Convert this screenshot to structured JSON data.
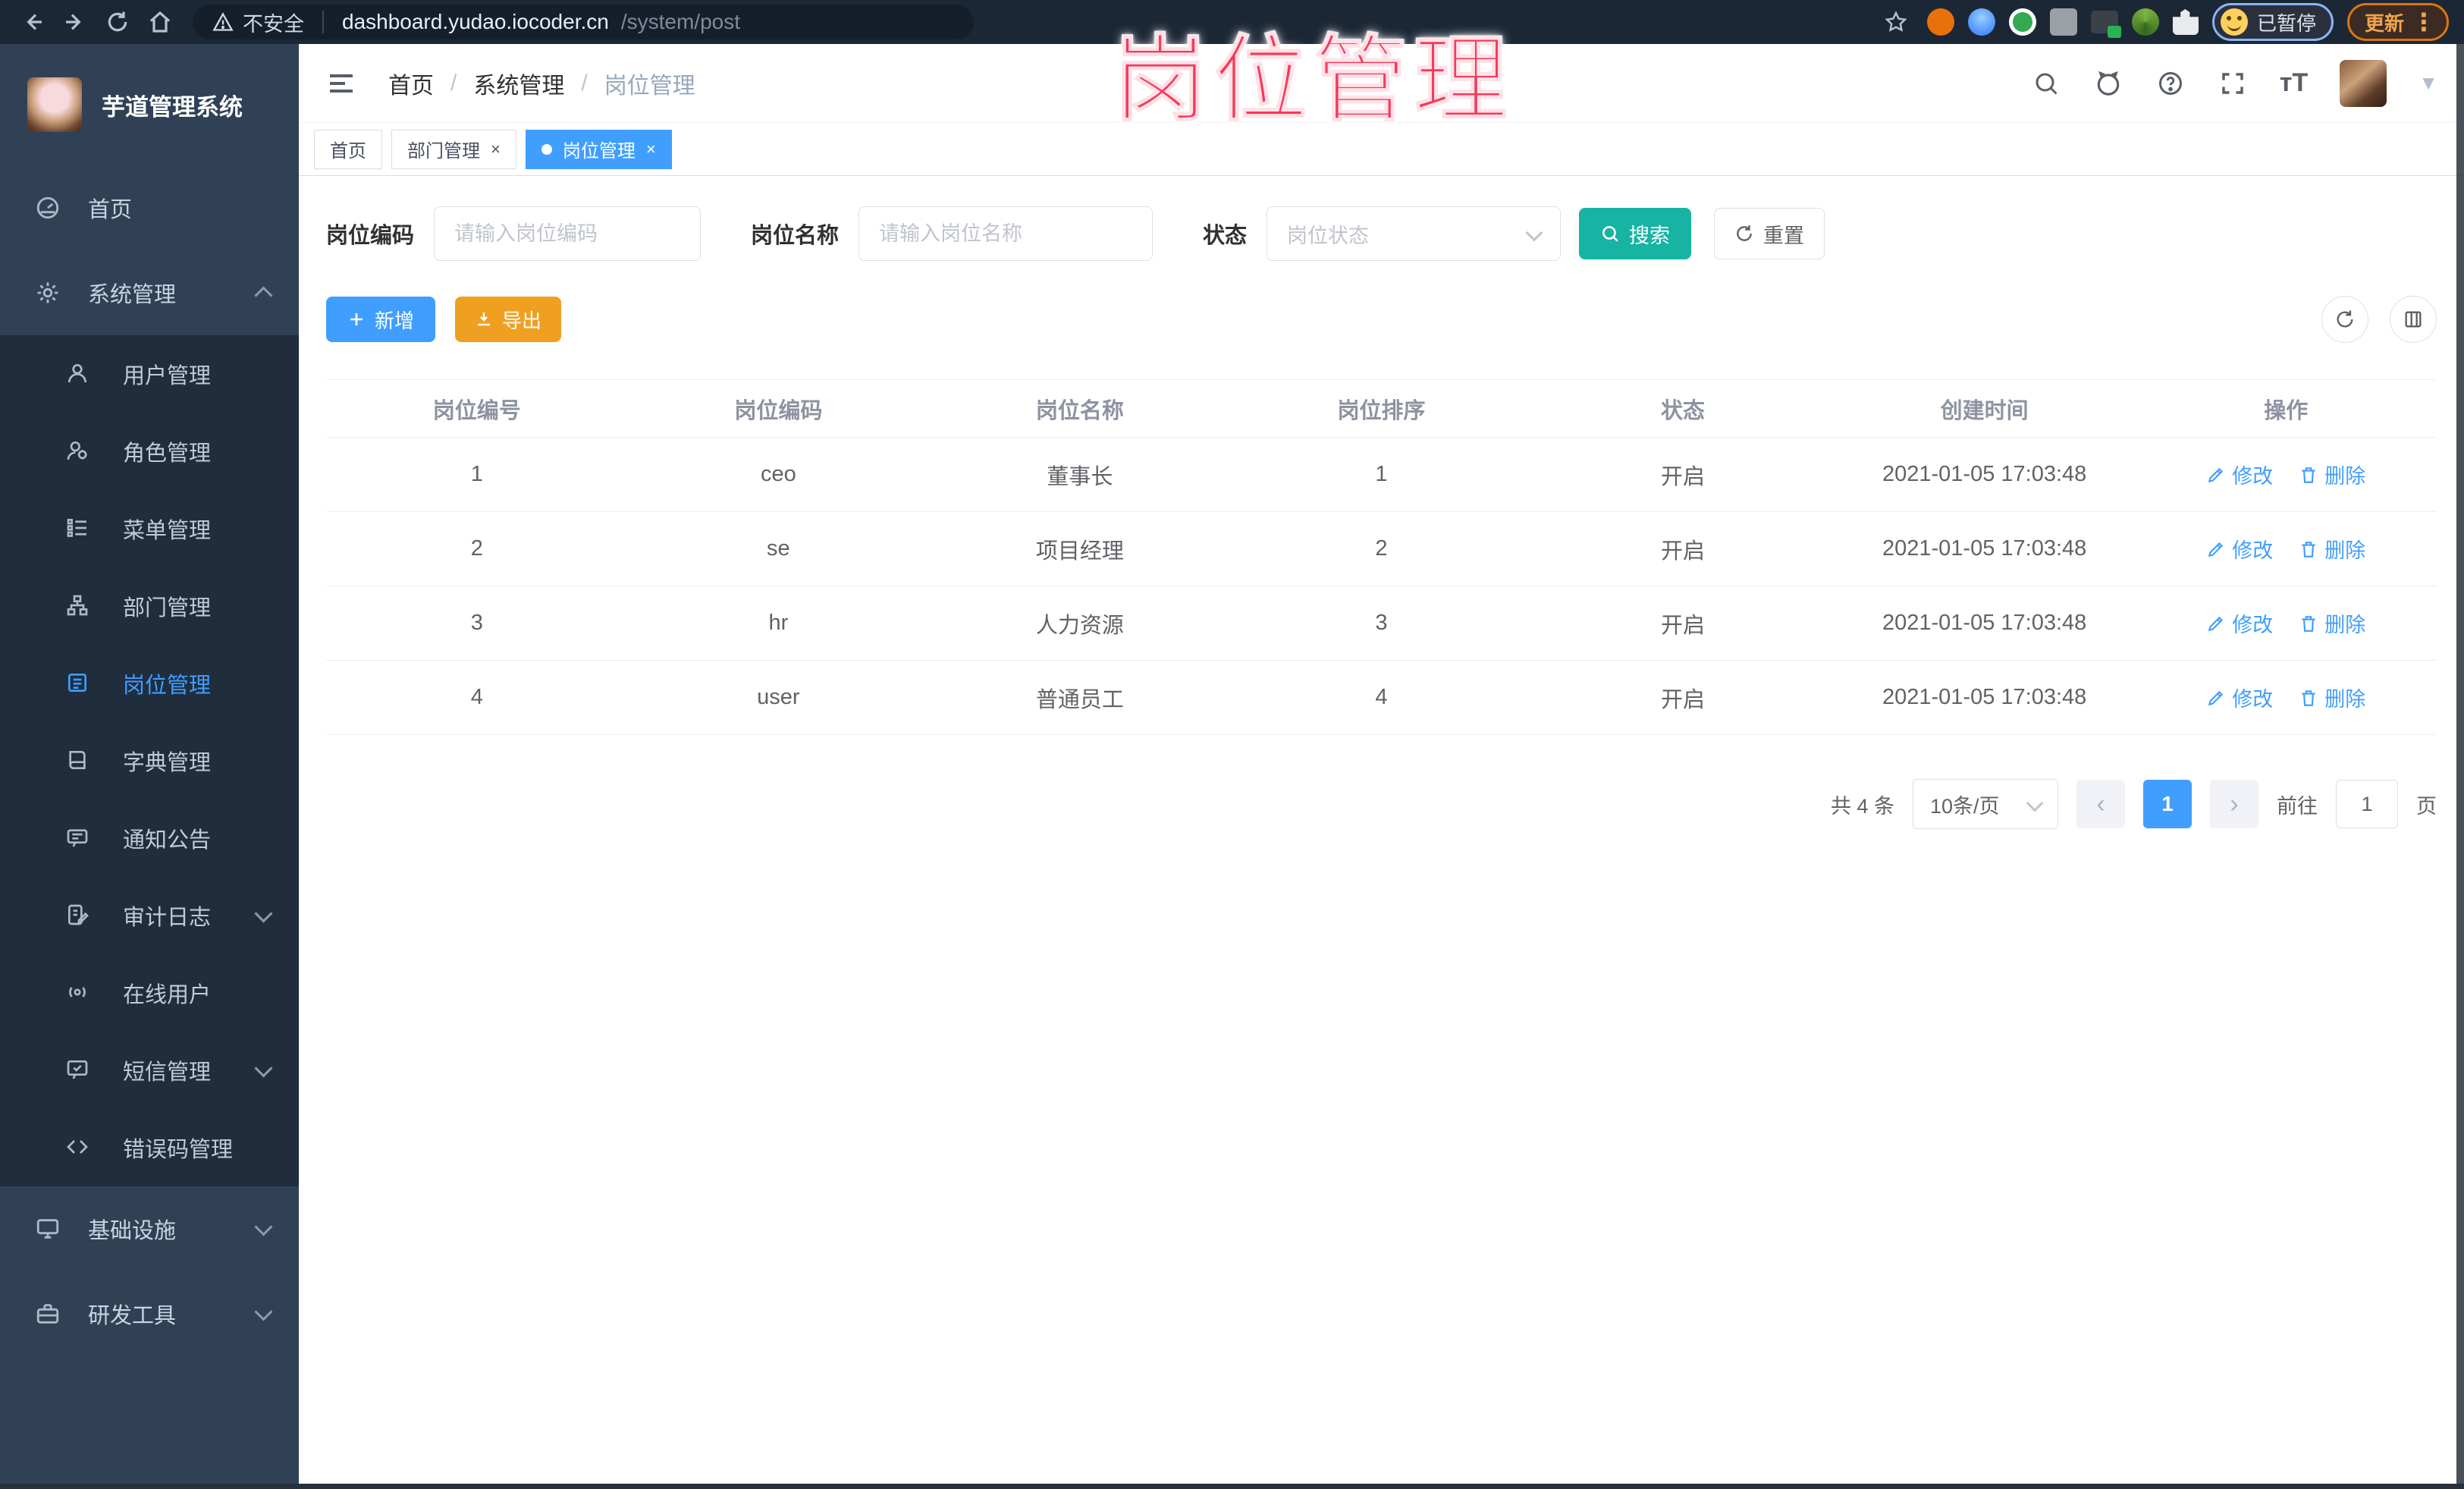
{
  "browser": {
    "security_label": "不安全",
    "url_host": "dashboard.yudao.iocoder.cn",
    "url_path": "/system/post",
    "paused_label": "已暂停",
    "update_label": "更新"
  },
  "overlay": {
    "title": "岗位管理"
  },
  "sidebar": {
    "app_title": "芋道管理系统",
    "top_items": [
      {
        "label": "首页"
      },
      {
        "label": "系统管理"
      }
    ],
    "submenu_items": [
      {
        "label": "用户管理"
      },
      {
        "label": "角色管理"
      },
      {
        "label": "菜单管理"
      },
      {
        "label": "部门管理"
      },
      {
        "label": "岗位管理"
      },
      {
        "label": "字典管理"
      },
      {
        "label": "通知公告"
      },
      {
        "label": "审计日志"
      },
      {
        "label": "在线用户"
      },
      {
        "label": "短信管理"
      },
      {
        "label": "错误码管理"
      }
    ],
    "bottom_items": [
      {
        "label": "基础设施"
      },
      {
        "label": "研发工具"
      }
    ]
  },
  "header": {
    "breadcrumb": [
      "首页",
      "系统管理",
      "岗位管理"
    ]
  },
  "tabs": [
    {
      "label": "首页"
    },
    {
      "label": "部门管理"
    },
    {
      "label": "岗位管理"
    }
  ],
  "filters": {
    "post_code_label": "岗位编码",
    "post_code_placeholder": "请输入岗位编码",
    "post_name_label": "岗位名称",
    "post_name_placeholder": "请输入岗位名称",
    "status_label": "状态",
    "status_placeholder": "岗位状态",
    "search_label": "搜索",
    "reset_label": "重置"
  },
  "toolbar": {
    "add_label": "新增",
    "export_label": "导出"
  },
  "table": {
    "headers": [
      "岗位编号",
      "岗位编码",
      "岗位名称",
      "岗位排序",
      "状态",
      "创建时间",
      "操作"
    ],
    "edit_label": "修改",
    "delete_label": "删除",
    "rows": [
      {
        "id": "1",
        "code": "ceo",
        "name": "董事长",
        "sort": "1",
        "status": "开启",
        "created": "2021-01-05 17:03:48"
      },
      {
        "id": "2",
        "code": "se",
        "name": "项目经理",
        "sort": "2",
        "status": "开启",
        "created": "2021-01-05 17:03:48"
      },
      {
        "id": "3",
        "code": "hr",
        "name": "人力资源",
        "sort": "3",
        "status": "开启",
        "created": "2021-01-05 17:03:48"
      },
      {
        "id": "4",
        "code": "user",
        "name": "普通员工",
        "sort": "4",
        "status": "开启",
        "created": "2021-01-05 17:03:48"
      }
    ]
  },
  "pagination": {
    "total_label": "共 4 条",
    "page_size": "10条/页",
    "current_page": "1",
    "goto_label": "前往",
    "goto_value": "1",
    "page_unit": "页"
  },
  "colors": {
    "accent_blue": "#409eff",
    "search_teal": "#17b3a3",
    "export_orange": "#f0a020",
    "overlay_pink": "#f43b5c",
    "sidebar_bg": "#304156",
    "submenu_bg": "#1f2d3d"
  }
}
